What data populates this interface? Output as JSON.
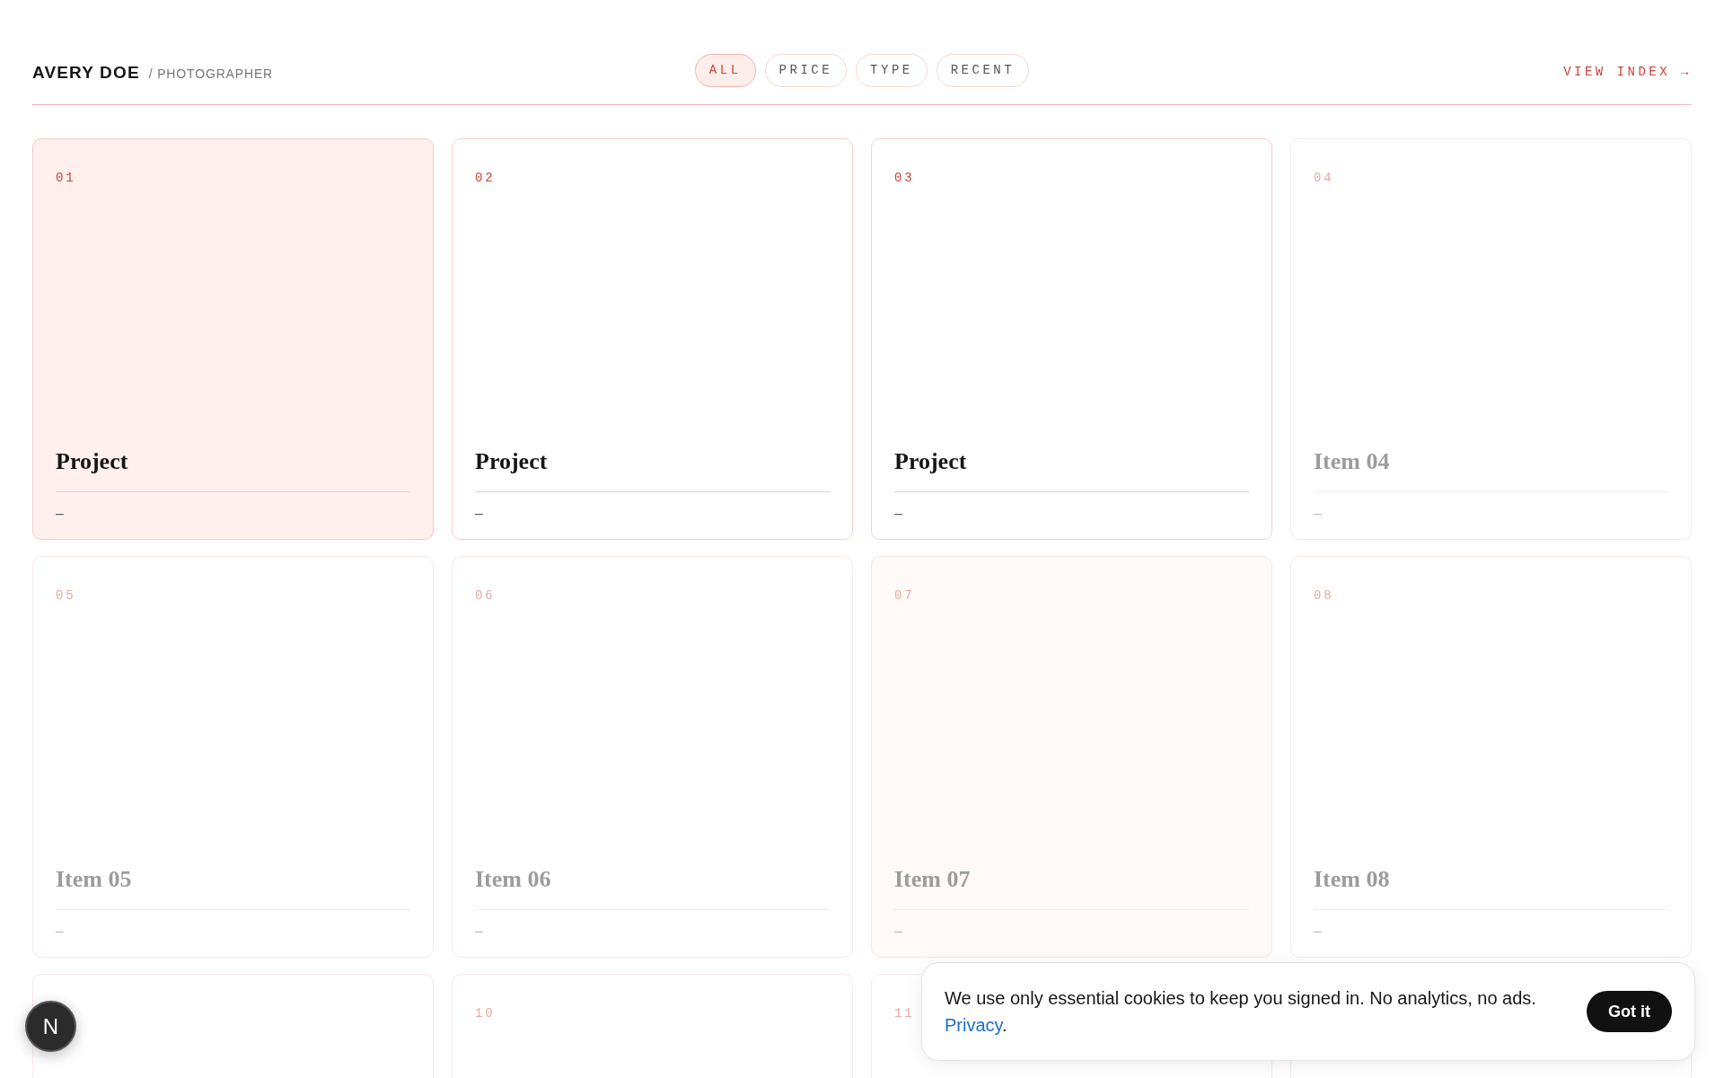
{
  "header": {
    "name": "AVERY DOE",
    "role": "/ PHOTOGRAPHER",
    "link": "VIEW INDEX →"
  },
  "filters": [
    {
      "label": "ALL",
      "selected": true
    },
    {
      "label": "PRICE",
      "selected": false
    },
    {
      "label": "TYPE",
      "selected": false
    },
    {
      "label": "RECENT",
      "selected": false
    }
  ],
  "cards": [
    {
      "number": "01",
      "title": "Project",
      "meta": "–",
      "kind": "selected"
    },
    {
      "number": "02",
      "title": "Project",
      "meta": "–",
      "kind": "plain"
    },
    {
      "number": "03",
      "title": "Project",
      "meta": "–",
      "kind": "plain"
    },
    {
      "number": "04",
      "title": "Item 04",
      "meta": "–",
      "kind": "muted"
    },
    {
      "number": "05",
      "title": "Item 05",
      "meta": "–",
      "kind": "muted"
    },
    {
      "number": "06",
      "title": "Item 06",
      "meta": "–",
      "kind": "muted"
    },
    {
      "number": "07",
      "title": "Item 07",
      "meta": "–",
      "kind": "hovered"
    },
    {
      "number": "08",
      "title": "Item 08",
      "meta": "–",
      "kind": "muted"
    },
    {
      "kind": "muted"
    },
    {
      "number": "10",
      "kind": "muted"
    },
    {
      "number": "11",
      "kind": "muted"
    },
    {
      "kind": "muted"
    }
  ],
  "cookie_banner": {
    "text": "We use only essential cookies to keep you signed in. No analytics, no ads.",
    "link": "Privacy",
    "after_link": ".",
    "button": "Got it"
  },
  "badge": {
    "letter": "N"
  }
}
